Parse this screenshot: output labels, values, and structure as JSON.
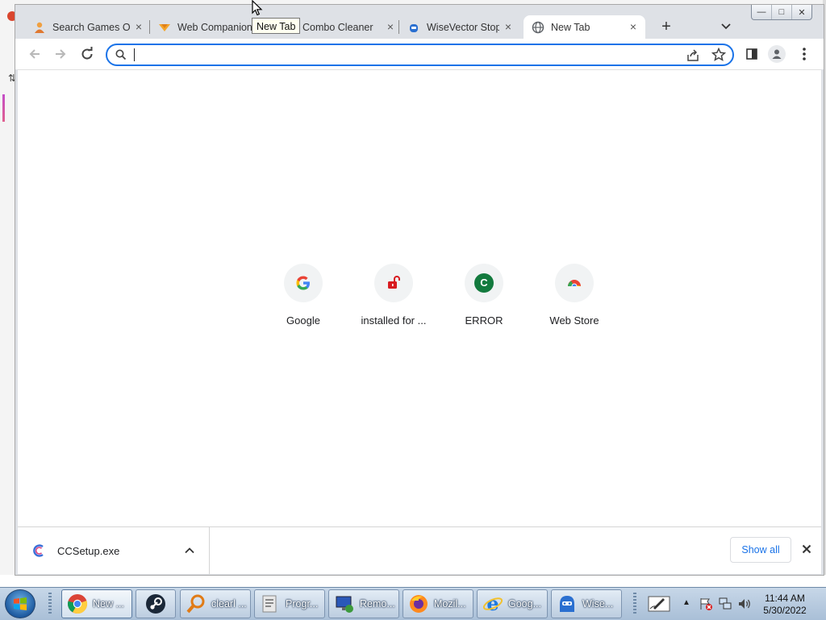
{
  "tabs": [
    {
      "title": "Search Games Onl",
      "icon": "games-person-icon",
      "active": false
    },
    {
      "title": "Web Companion",
      "icon": "web-companion-icon",
      "active": false
    },
    {
      "title": "Combo Cleaner",
      "icon": "combo-cleaner-icon",
      "active": false
    },
    {
      "title": "WiseVector Stop",
      "icon": "wisevector-icon",
      "active": false
    },
    {
      "title": "New Tab",
      "icon": "globe-icon",
      "active": true
    }
  ],
  "tooltip": "New Tab",
  "omnibox": {
    "value": "",
    "placeholder": ""
  },
  "shortcuts": [
    {
      "label": "Google",
      "icon": "google-icon"
    },
    {
      "label": "installed for ...",
      "icon": "red-lock-icon"
    },
    {
      "label": "ERROR",
      "icon": "green-c-icon",
      "letter": "C"
    },
    {
      "label": "Web Store",
      "icon": "web-store-icon"
    }
  ],
  "download": {
    "filename": "CCSetup.exe",
    "show_all": "Show all"
  },
  "taskbar": {
    "items": [
      {
        "label": "New ...",
        "icon": "chrome-icon"
      },
      {
        "label": "",
        "icon": "steam-icon"
      },
      {
        "label": "clearl ...",
        "icon": "magnifier-icon"
      },
      {
        "label": "Progr...",
        "icon": "programs-icon"
      },
      {
        "label": "Remo...",
        "icon": "remove-icon"
      },
      {
        "label": "Mozil...",
        "icon": "firefox-icon"
      },
      {
        "label": "Goog...",
        "icon": "ie-icon"
      },
      {
        "label": "Wise...",
        "icon": "wise-icon"
      }
    ],
    "time": "11:44 AM",
    "date": "5/30/2022"
  },
  "colors": {
    "accent": "#1a73e8",
    "tab_strip": "#dee1e6",
    "taskbar": "#b8cbe0"
  }
}
